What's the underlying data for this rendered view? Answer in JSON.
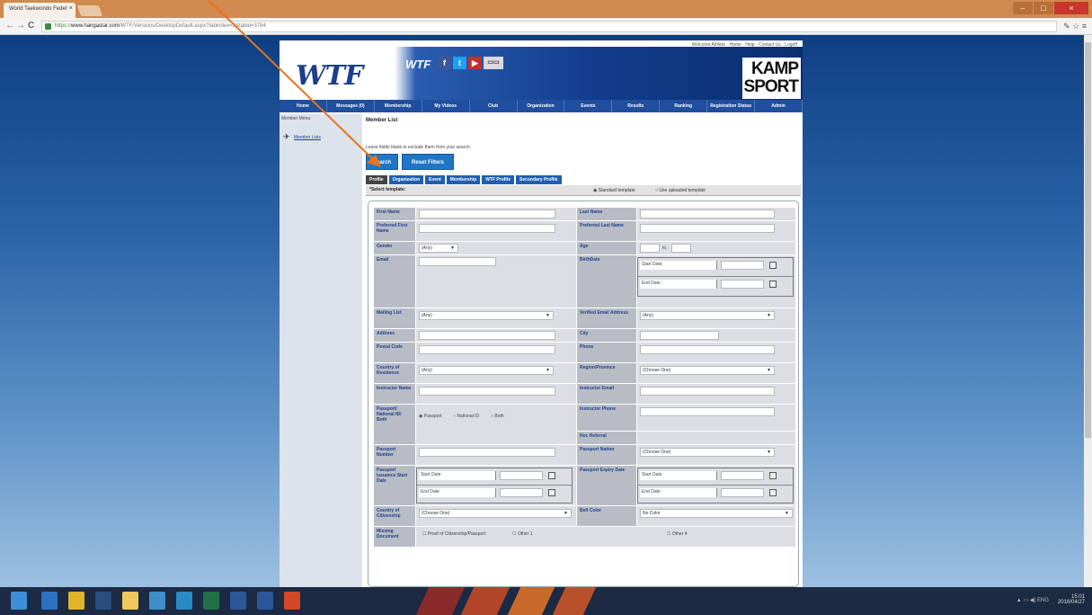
{
  "browser": {
    "tab_title": "World Taekwondo Feder",
    "tab_close": "×",
    "url_scheme": "https",
    "url_host": "www.hangastar.com",
    "url_rest": "/WTF/Versions/DesktopDefault.aspx?tabindex=3&tabid=3784",
    "back": "←",
    "forward": "→",
    "reload": "C",
    "win_min": "–",
    "win_max": "□",
    "win_close": "×",
    "toolbar_icons": "✎ ☆ ≡"
  },
  "site": {
    "toplinks": "Welcome Athlete · Home · Help · Contact Us · Logoff",
    "logo_main": "WTF",
    "logo_small": "WTF",
    "social": {
      "fb": "f",
      "tw": "t",
      "yt": "▶",
      "cal": "▭▭"
    },
    "sponsor_line1": "KAMP",
    "sponsor_line2": "SPORT",
    "nav": [
      "Home",
      "Messages (0)",
      "Membership",
      "My Videos",
      "Club",
      "Organization",
      "Events",
      "Results",
      "Ranking",
      "Registration Status",
      "Admin"
    ]
  },
  "sidebar": {
    "title": "Member Menu",
    "item": "Member Lists"
  },
  "content": {
    "title": "Member List",
    "note": "Leave fields blank to exclude them from your search.",
    "search_btn": "Search",
    "reset_btn": "Reset Filters",
    "tabs": [
      "Profile",
      "Organization",
      "Event",
      "Membership",
      "WTF Profile",
      "Secondary Profile"
    ],
    "template_label": "*Select template:",
    "template_opt1": "Standard template",
    "template_opt2": "Use uploaded template"
  },
  "form": {
    "first_name": "First Name",
    "last_name": "Last Name",
    "pref_first": "Preferred First Name",
    "pref_last": "Preferred Last Name",
    "gender": "Gender",
    "gender_val": "(Any)",
    "age": "Age",
    "age_to": "to",
    "email": "Email",
    "birthdate": "BirthDate",
    "start_date": "Start Date",
    "end_date": "End Date",
    "mailing_list": "Mailing List",
    "mailing_val": "(Any)",
    "verified_email": "Verified Email Address",
    "verified_val": "(Any)",
    "address": "Address",
    "city": "City",
    "postal": "Postal Code",
    "phone": "Phone",
    "country_res": "Country of Residence",
    "country_res_val": "(Any)",
    "region": "Region/Province",
    "region_val": "(Choose One)",
    "instructor_name": "Instructor Name",
    "instructor_email": "Instructor Email",
    "passport_group": "Passport/ National ID/ Both",
    "r_passport": "Passport",
    "r_national": "National ID",
    "r_both": "Both",
    "instructor_phone": "Instructor Phone",
    "hoc_referral": "Hoc Referral",
    "passport_number": "Passport Number",
    "passport_nation": "Passport Nation",
    "passport_nation_val": "(Choose One)",
    "passport_issuance": "Passport Issuance Start Date",
    "passport_expiry": "Passport Expiry Date",
    "citizenship": "Country of Citizenship",
    "citizenship_val": "(Choose One)",
    "belt_color": "Belt Color",
    "belt_val": "No Color",
    "missing_docs": "Missing Document",
    "missing_opt1": "Proof of Citizenship/Passport",
    "missing_opt2": "Other 1",
    "missing_opt3": "Other 4"
  },
  "taskbar": {
    "tray": "▲ ▭ ◀) ENG",
    "clock_time": "15:01",
    "clock_date": "2016/04/27"
  },
  "colors": {
    "accent_orange": "#e8741e",
    "nav_blue": "#1f4f9e",
    "button_blue": "#1f76c4"
  }
}
